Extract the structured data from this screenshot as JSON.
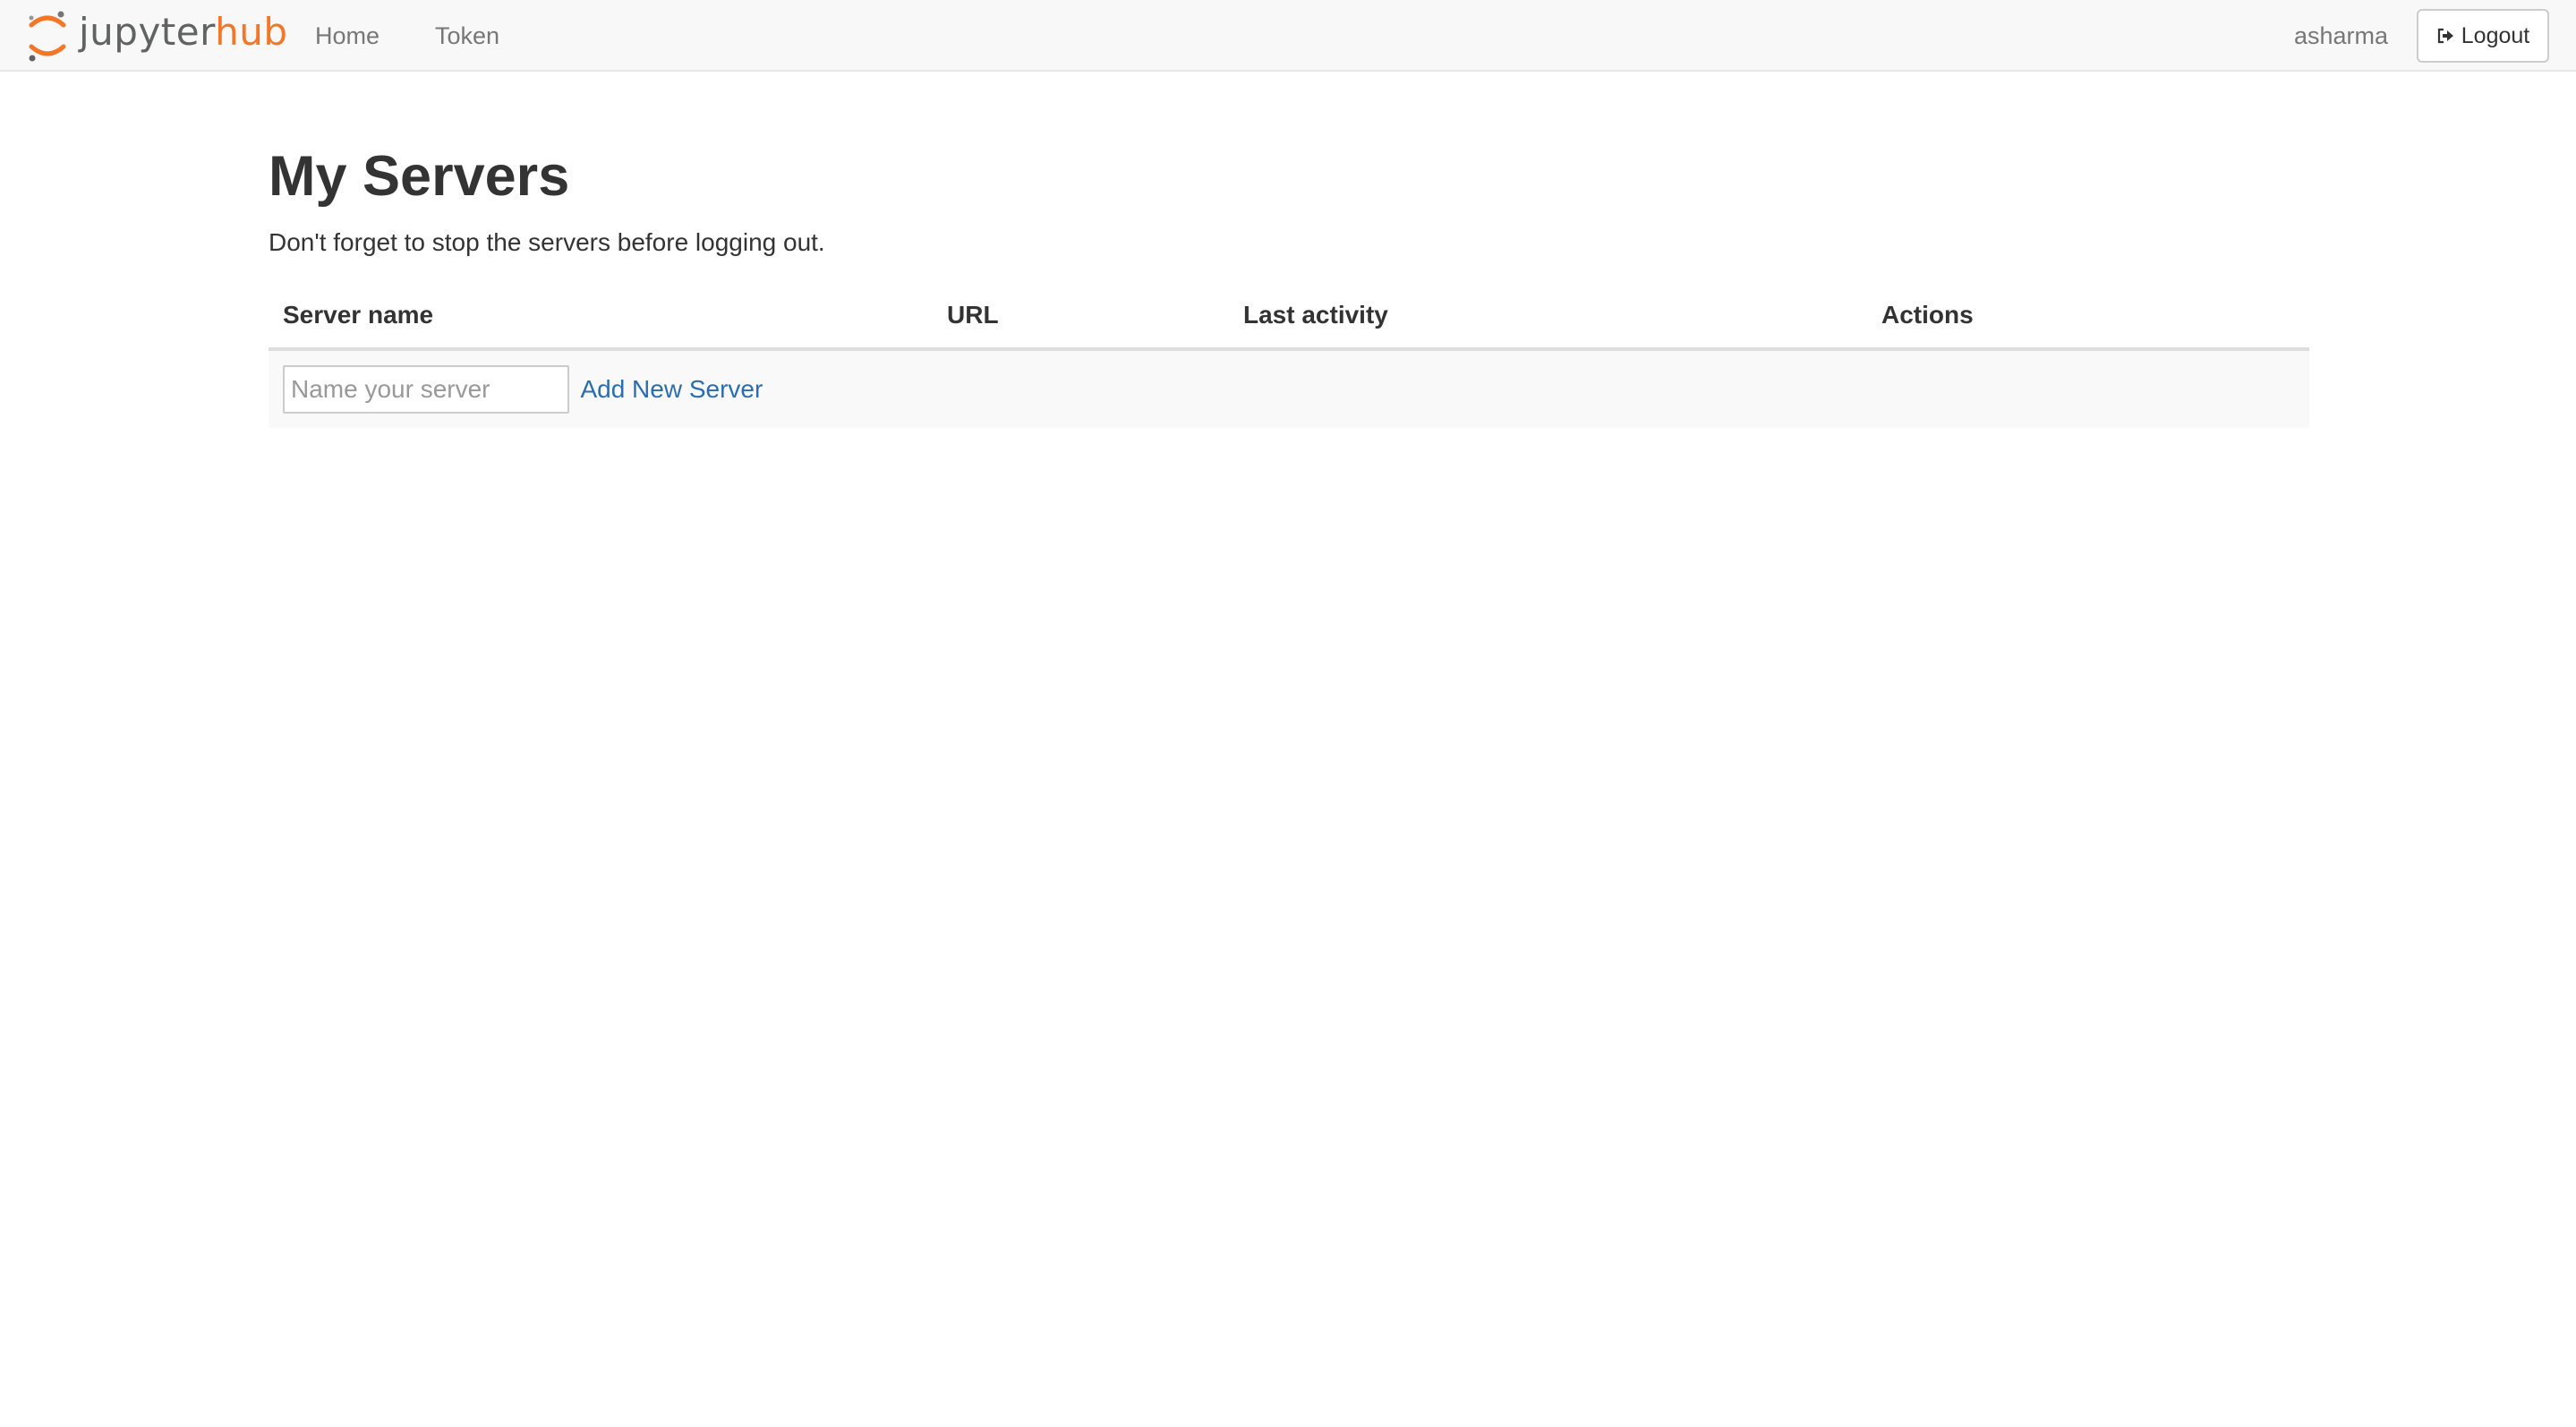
{
  "navbar": {
    "logo": {
      "word_part1": "jupyter",
      "word_part2": "hub",
      "icon": "jupyter-logo-icon"
    },
    "links": [
      {
        "label": "Home"
      },
      {
        "label": "Token"
      }
    ],
    "username": "asharma",
    "logout": {
      "label": "Logout",
      "icon": "sign-out-icon"
    }
  },
  "main": {
    "title": "My Servers",
    "note": "Don't forget to stop the servers before logging out.",
    "table": {
      "columns": [
        "Server name",
        "URL",
        "Last activity",
        "Actions"
      ],
      "new_server": {
        "placeholder": "Name your server",
        "value": "",
        "add_label": "Add New Server"
      }
    }
  },
  "colors": {
    "brand_orange": "#f37726",
    "brand_gray": "#616262",
    "link_blue": "#2a6db0",
    "navbar_bg": "#f8f8f8"
  }
}
